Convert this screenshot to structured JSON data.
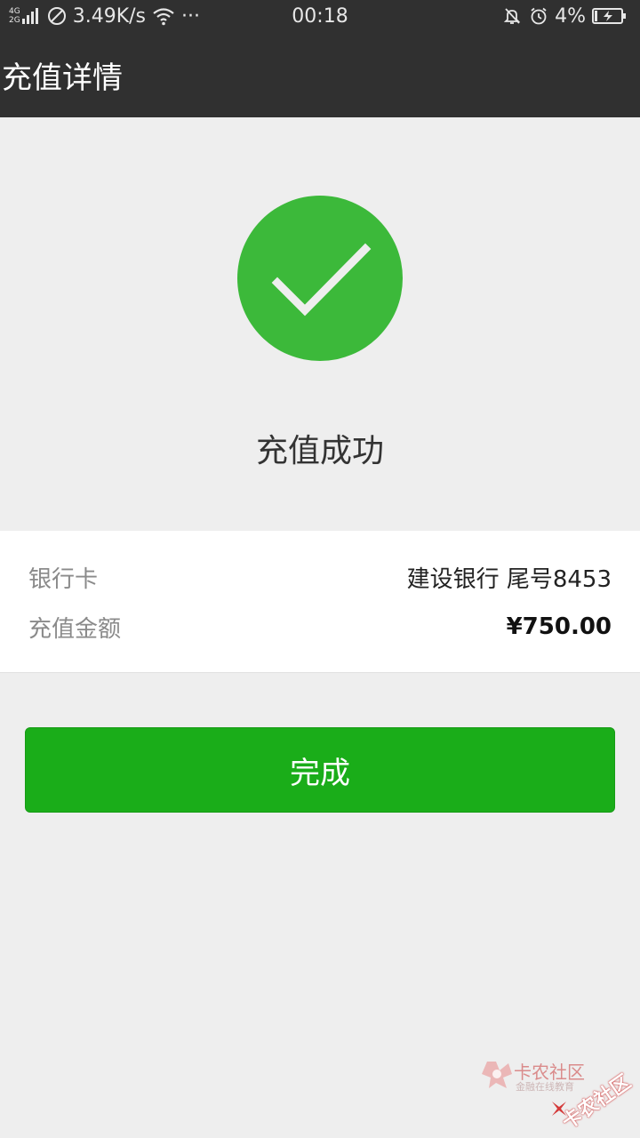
{
  "status_bar": {
    "network_top": "4G",
    "network_bottom": "2G",
    "speed": "3.49K/s",
    "more": "···",
    "time": "00:18",
    "battery": "4%",
    "icons": [
      "signal-icon",
      "no-sim-icon",
      "wifi-icon",
      "bell-muted-icon",
      "alarm-icon",
      "battery-charging-icon"
    ]
  },
  "header": {
    "title": "充值详情"
  },
  "result": {
    "title": "充值成功",
    "icon": "check-circle-icon",
    "icon_color": "#3cb93a"
  },
  "details": {
    "rows": [
      {
        "label": "银行卡",
        "value": "建设银行 尾号8453"
      },
      {
        "label": "充值金额",
        "value": "¥750.00"
      }
    ]
  },
  "actions": {
    "done_label": "完成",
    "done_color": "#1aad19"
  },
  "watermark": {
    "brand": "卡农社区",
    "tagline": "金融在线教育",
    "brand_rotated": "卡农社区",
    "accent": "#d43a3a"
  }
}
